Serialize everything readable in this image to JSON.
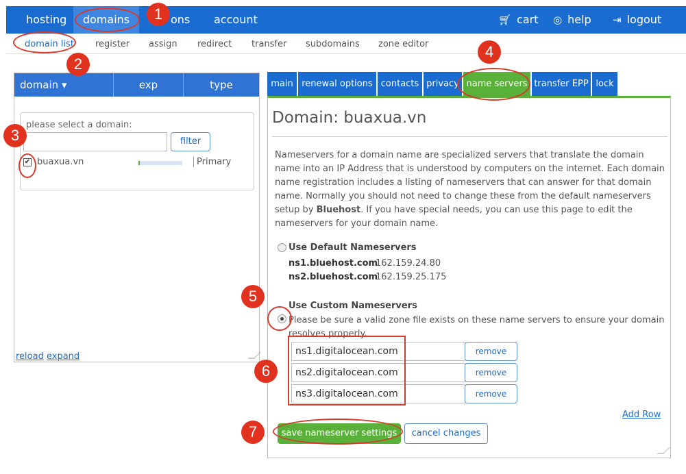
{
  "topnav": {
    "items": [
      {
        "label": "hosting"
      },
      {
        "label": "domains"
      },
      {
        "label": "ons"
      },
      {
        "label": "account"
      }
    ],
    "right": {
      "cart": "cart",
      "help": "help",
      "logout": "logout"
    }
  },
  "subnav": {
    "items": [
      {
        "label": "domain list"
      },
      {
        "label": "register"
      },
      {
        "label": "assign"
      },
      {
        "label": "redirect"
      },
      {
        "label": "transfer"
      },
      {
        "label": "subdomains"
      },
      {
        "label": "zone editor"
      }
    ]
  },
  "left_panel": {
    "headers": [
      "domain ▾",
      "exp",
      "type"
    ],
    "select_label": "please select a domain:",
    "filter_label": "filter",
    "row": {
      "name": "buaxua.vn",
      "type": "Primary",
      "checked": true
    },
    "footer": {
      "reload": "reload",
      "expand": "expand"
    }
  },
  "tabs": [
    {
      "label": "main"
    },
    {
      "label": "renewal options"
    },
    {
      "label": "contacts"
    },
    {
      "label": "privacy"
    },
    {
      "label": "name servers"
    },
    {
      "label": "transfer EPP"
    },
    {
      "label": "lock"
    }
  ],
  "main": {
    "title": "Domain: buaxua.vn",
    "description_1": "Nameservers for a domain name are specialized servers that translate the domain name into an IP Address that is understood by computers on the internet. Each domain name registration includes a listing of nameservers that can answer for that domain name. Normally you should not need to change these from the default nameservers setup by ",
    "description_bold": "Bluehost",
    "description_2": ". If you have special needs, you can use this page to edit the nameservers for your domain name.",
    "default_option": {
      "label": "Use Default Nameservers",
      "servers": [
        {
          "host": "ns1.bluehost.com",
          "ip": "162.159.24.80"
        },
        {
          "host": "ns2.bluehost.com",
          "ip": "162.159.25.175"
        }
      ]
    },
    "custom_option": {
      "label": "Use Custom Nameservers",
      "note": "Please be sure a valid zone file exists on these name servers to ensure your domain resolves properly.",
      "servers": [
        "ns1.digitalocean.com",
        "ns2.digitalocean.com",
        "ns3.digitalocean.com"
      ],
      "remove_label": "remove"
    },
    "add_row": "Add Row",
    "save_label": "save nameserver settings",
    "cancel_label": "cancel changes"
  },
  "annotations": [
    "1",
    "2",
    "3",
    "4",
    "5",
    "6",
    "7"
  ],
  "colors": {
    "nav_blue": "#1a6cd1",
    "active_green": "#5ab13a",
    "annotation_red": "#e0321f"
  }
}
